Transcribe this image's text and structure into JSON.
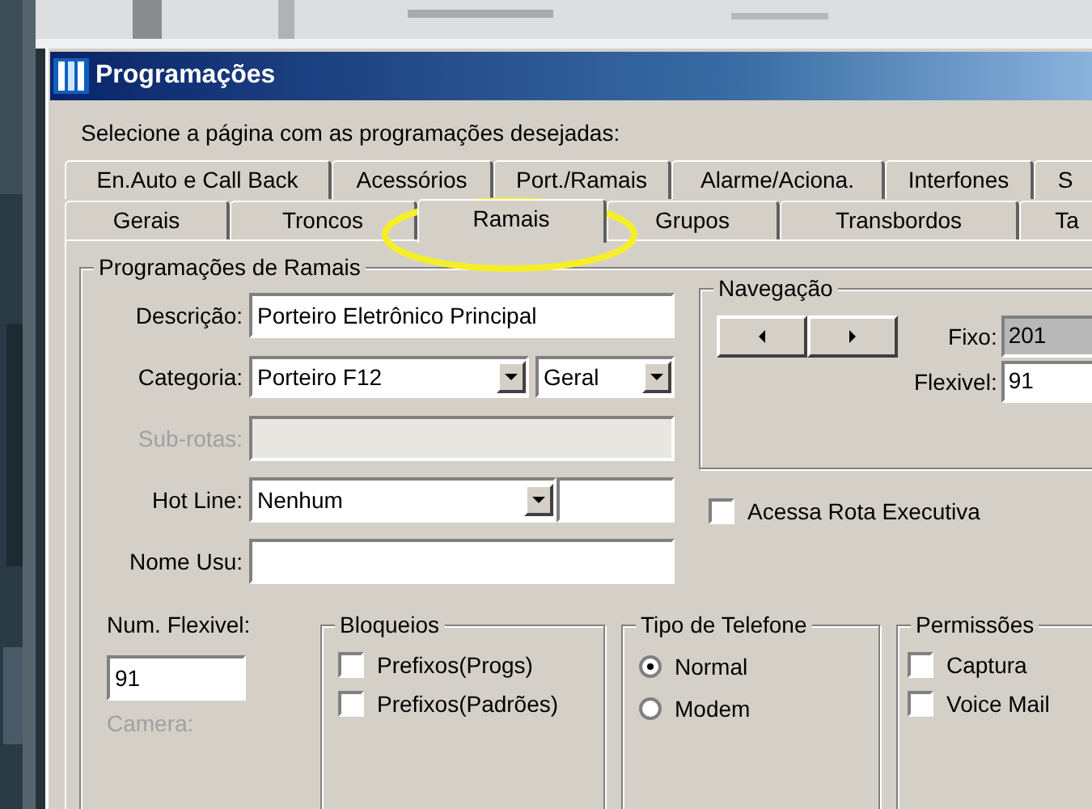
{
  "window": {
    "title": "Programações"
  },
  "instruction": "Selecione a página com as programações desejadas:",
  "tab_rows": [
    {
      "tabs": [
        {
          "label": "En.Auto e Call Back",
          "selected": false
        },
        {
          "label": "Acessórios",
          "selected": false
        },
        {
          "label": "Port./Ramais",
          "selected": false
        },
        {
          "label": "Alarme/Aciona.",
          "selected": false
        },
        {
          "label": "Interfones",
          "selected": false
        },
        {
          "label": "S",
          "selected": false
        }
      ]
    },
    {
      "tabs": [
        {
          "label": "Gerais",
          "selected": false
        },
        {
          "label": "Troncos",
          "selected": false
        },
        {
          "label": "Ramais",
          "selected": true
        },
        {
          "label": "Grupos",
          "selected": false
        },
        {
          "label": "Transbordos",
          "selected": false
        },
        {
          "label": "Ta",
          "selected": false
        }
      ]
    }
  ],
  "group": {
    "title": "Programações de Ramais"
  },
  "fields": [
    {
      "label": "Descrição:",
      "kind": "text",
      "value": "Porteiro Eletrônico Principal",
      "disabled": false
    },
    {
      "label": "Categoria:",
      "kind": "double-dropdown",
      "value": "Porteiro F12",
      "value2": "Geral",
      "disabled": false
    },
    {
      "label": "Sub-rotas:",
      "kind": "text",
      "disabled": true
    },
    {
      "label": "Hot Line:",
      "kind": "dropdown-extra",
      "value": "Nenhum",
      "disabled": false
    },
    {
      "label": "Nome Usu:",
      "kind": "text",
      "disabled": false
    }
  ],
  "navigation": {
    "title": "Navegação",
    "fixo_label": "Fixo:",
    "fixo_value": "201",
    "flexivel_label": "Flexivel:",
    "flexivel_value": "91"
  },
  "acessa_rota": {
    "label": "Acessa Rota Executiva",
    "checked": false
  },
  "num_flexivel": {
    "label": "Num. Flexivel:",
    "value": "91"
  },
  "camera": {
    "label": "Camera:",
    "disabled": true
  },
  "bloqueios": {
    "title": "Bloqueios",
    "items": [
      {
        "label": "Prefixos(Progs)",
        "checked": false
      },
      {
        "label": "Prefixos(Padrões)",
        "checked": false
      }
    ]
  },
  "tipo_telefone": {
    "title": "Tipo de Telefone",
    "options": [
      {
        "label": "Normal",
        "selected": true
      },
      {
        "label": "Modem",
        "selected": false
      }
    ]
  },
  "permissoes": {
    "title": "Permissões",
    "items": [
      {
        "label": "Captura",
        "checked": false
      },
      {
        "label": "Voice Mail",
        "checked": false
      }
    ]
  }
}
